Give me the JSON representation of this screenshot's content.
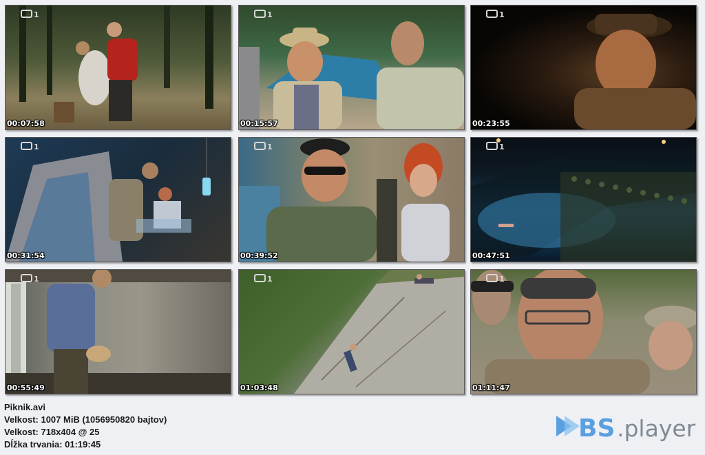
{
  "channel_logo": "1",
  "thumbnails": [
    {
      "timestamp": "00:07:58"
    },
    {
      "timestamp": "00:15:57"
    },
    {
      "timestamp": "00:23:55"
    },
    {
      "timestamp": "00:31:54"
    },
    {
      "timestamp": "00:39:52"
    },
    {
      "timestamp": "00:47:51"
    },
    {
      "timestamp": "00:55:49"
    },
    {
      "timestamp": "01:03:48"
    },
    {
      "timestamp": "01:11:47"
    }
  ],
  "info": {
    "filename": "Piknik.avi",
    "size": "Velkost: 1007 MiB (1056950820 bajtov)",
    "resolution": "Velkost: 718x404 @ 25",
    "duration": "Dĺžka trvania: 01:19:45"
  },
  "brand": {
    "logo_text_bs": "BS",
    "logo_text_player": ".player",
    "colors": {
      "bs": "#5a9fe0",
      "player": "#808a94"
    }
  }
}
